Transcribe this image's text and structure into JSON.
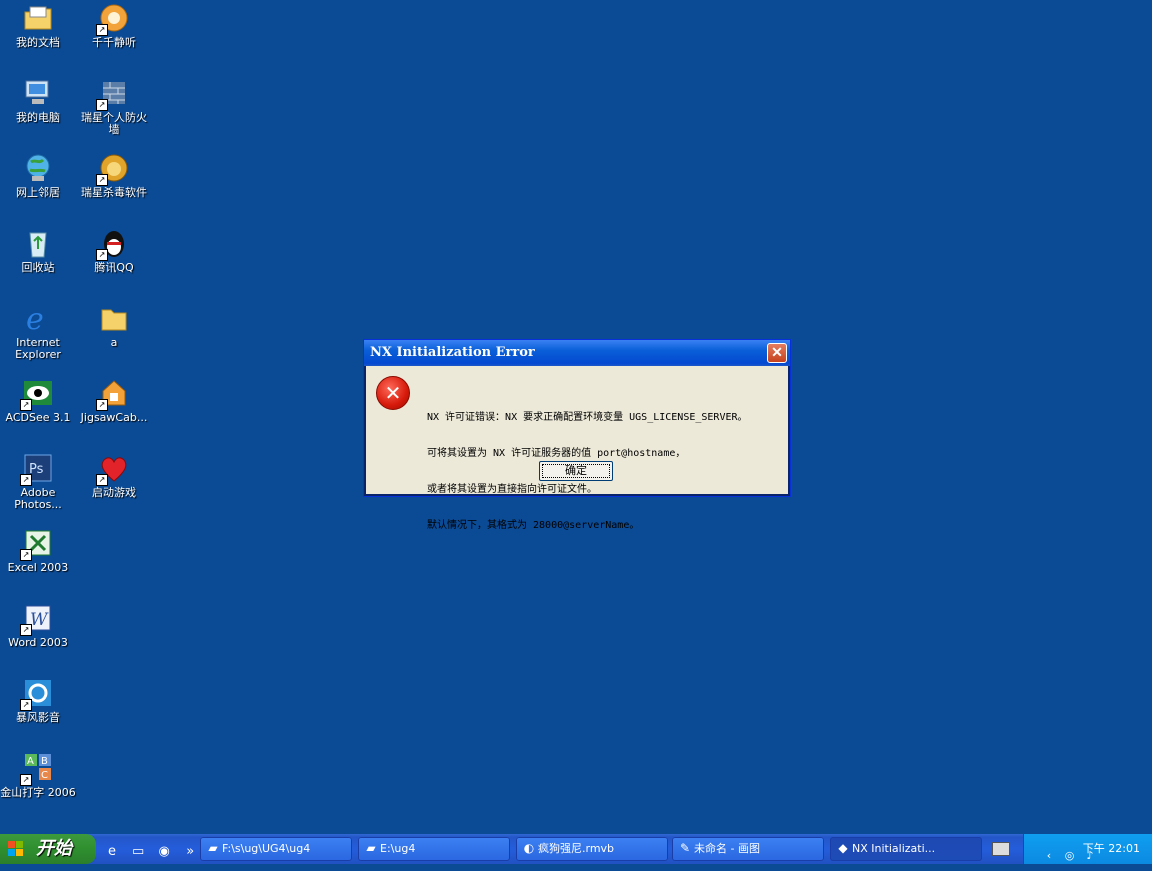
{
  "desktop": {
    "icons": [
      {
        "label": "我的文档",
        "icon": "my-documents-folder",
        "shortcut": false
      },
      {
        "label": "千千静听",
        "icon": "ttplayer",
        "shortcut": true
      },
      {
        "label": "我的电脑",
        "icon": "my-computer",
        "shortcut": false
      },
      {
        "label": "瑞星个人防火墙",
        "icon": "rising-firewall",
        "shortcut": true
      },
      {
        "label": "网上邻居",
        "icon": "network-places",
        "shortcut": false
      },
      {
        "label": "瑞星杀毒软件",
        "icon": "rising-antivirus",
        "shortcut": true
      },
      {
        "label": "回收站",
        "icon": "recycle-bin",
        "shortcut": false
      },
      {
        "label": "腾讯QQ",
        "icon": "qq-penguin",
        "shortcut": true
      },
      {
        "label": "Internet Explorer",
        "icon": "internet-explorer",
        "shortcut": false
      },
      {
        "label": "a",
        "icon": "folder",
        "shortcut": false
      },
      {
        "label": "ACDSee 3.1",
        "icon": "acdsee-eye",
        "shortcut": true
      },
      {
        "label": "JigsawCab...",
        "icon": "jigsaw-cabinet",
        "shortcut": true
      },
      {
        "label": "Adobe Photos...",
        "icon": "photoshop",
        "shortcut": true
      },
      {
        "label": "启动游戏",
        "icon": "heart-game",
        "shortcut": true
      },
      {
        "label": "Excel 2003",
        "icon": "excel",
        "shortcut": true
      },
      {
        "label": "Word 2003",
        "icon": "word",
        "shortcut": true
      },
      {
        "label": "暴风影音",
        "icon": "storm-player",
        "shortcut": true
      },
      {
        "label": "金山打字 2006",
        "icon": "kingsoft-typing",
        "shortcut": true
      }
    ]
  },
  "dialog": {
    "title": "NX Initialization Error",
    "close_glyph": "✕",
    "icon": "error-icon",
    "message_lines": [
      "NX 许可证错误：NX 要求正确配置环境变量 UGS_LICENSE_SERVER。",
      "可将其设置为 NX 许可证服务器的值 port@hostname，",
      "或者将其设置为直接指向许可证文件。",
      "默认情况下，其格式为 28000@serverName。"
    ],
    "ok_label": "确定"
  },
  "taskbar": {
    "start_label": "开始",
    "quicklaunch_more": "»",
    "tasks": [
      {
        "label": "F:\\s\\ug\\UG4\\ug4",
        "icon": "folder-icon"
      },
      {
        "label": "E:\\ug4",
        "icon": "folder-icon"
      },
      {
        "label": "疯狗强尼.rmvb",
        "icon": "media-icon"
      },
      {
        "label": "未命名 - 画图",
        "icon": "paint-icon"
      },
      {
        "label": "NX Initializati...",
        "icon": "nx-icon"
      }
    ],
    "clock": "下午 22:01"
  },
  "colors": {
    "desktop": "#0b4a94",
    "taskbar": "#245ddb",
    "start": "#2f8f2f",
    "tray": "#0f9ef0"
  }
}
